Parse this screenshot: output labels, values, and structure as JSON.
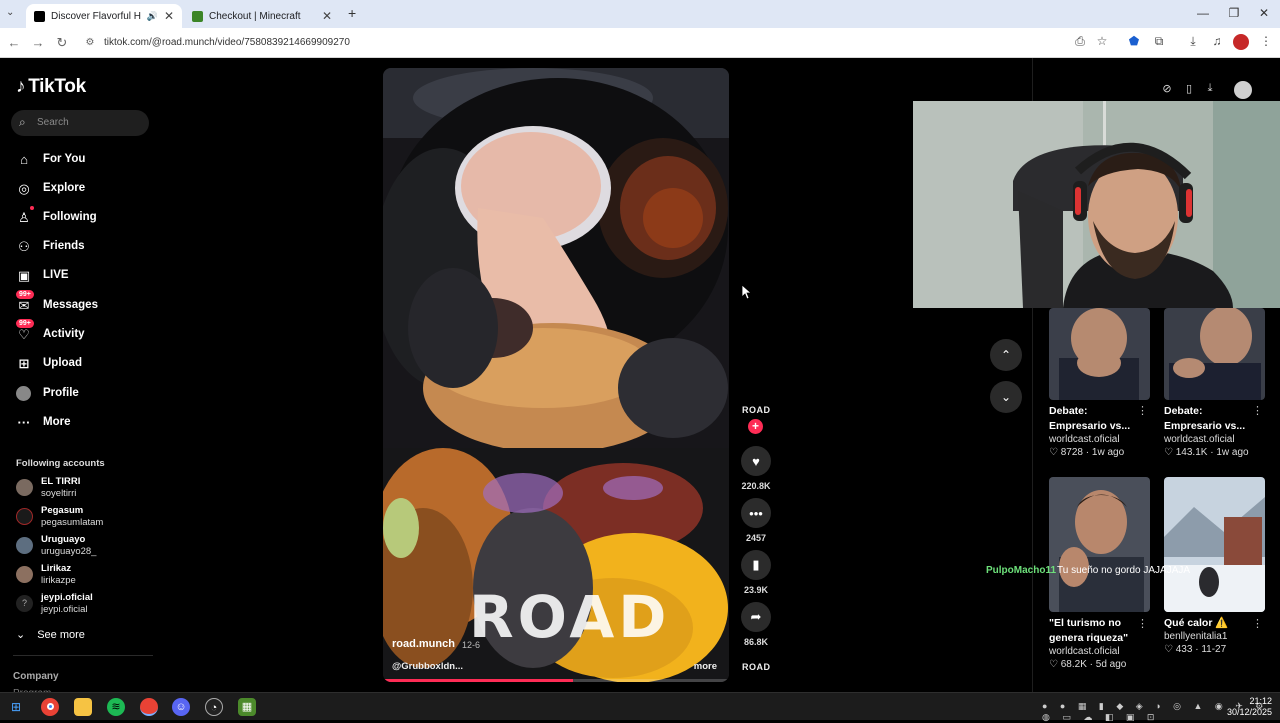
{
  "browser": {
    "tabs": [
      {
        "title": "Discover Flavorful Halal Stre",
        "active": true
      },
      {
        "title": "Checkout | Minecraft",
        "active": false
      }
    ],
    "new_tab_label": "+",
    "url": "tiktok.com/@road.munch/video/7580839214669909270"
  },
  "sidebar": {
    "logo": "TikTok",
    "search_placeholder": "Search",
    "nav": [
      {
        "label": "For You",
        "icon": "home-icon"
      },
      {
        "label": "Explore",
        "icon": "compass-icon"
      },
      {
        "label": "Following",
        "icon": "following-icon"
      },
      {
        "label": "Friends",
        "icon": "friends-icon"
      },
      {
        "label": "LIVE",
        "icon": "live-icon"
      },
      {
        "label": "Messages",
        "icon": "messages-icon",
        "badge": "99+"
      },
      {
        "label": "Activity",
        "icon": "activity-icon",
        "badge": "99+"
      },
      {
        "label": "Upload",
        "icon": "upload-icon"
      },
      {
        "label": "Profile",
        "icon": "profile-icon"
      },
      {
        "label": "More",
        "icon": "more-icon"
      }
    ],
    "following_title": "Following accounts",
    "accounts": [
      {
        "name": "EL TIRRI",
        "handle": "soyeltirri"
      },
      {
        "name": "Pegasum",
        "handle": "pegasumlatam"
      },
      {
        "name": "Uruguayo",
        "handle": "uruguayo28_"
      },
      {
        "name": "Lirikaz",
        "handle": "lirikazpe"
      },
      {
        "name": "jeypi.oficial",
        "handle": "jeypi.oficial"
      }
    ],
    "see_more": "See more",
    "company": "Company",
    "program": "Program"
  },
  "video": {
    "username": "road.munch",
    "date": "12-6",
    "caption": "@Grubboxldn...",
    "more": "more",
    "watermark": "ROAD",
    "progress": 0.55
  },
  "actions": {
    "brand": "ROAD",
    "likes": "220.8K",
    "comments": "2457",
    "saves": "23.9K",
    "shares": "86.8K"
  },
  "recommendations": [
    {
      "title_line1": "Debate:",
      "title_line2": "Empresario vs...",
      "author": "worldcast.oficial",
      "likes": "8728",
      "age": "1w ago"
    },
    {
      "title_line1": "Debate:",
      "title_line2": "Empresario vs...",
      "author": "worldcast.oficial",
      "likes": "143.1K",
      "age": "1w ago"
    },
    {
      "title_line1": "\"El turismo no",
      "title_line2": "genera riqueza\"",
      "author": "worldcast.oficial",
      "likes": "68.2K",
      "age": "5d ago"
    },
    {
      "title_line1": "Qué calor ⚠️",
      "title_line2": "",
      "author": "benllyenitalia1",
      "likes": "433",
      "age": "11-27"
    }
  ],
  "chat_overlay": {
    "user": "PulpoMacho11",
    "message": "Tu sueño no gordo JAJAJAJA"
  },
  "taskbar": {
    "time": "21:12",
    "date": "30/12/2025"
  },
  "colors": {
    "accent": "#fe2c55",
    "background": "#000000",
    "chat_name": "#6de07a"
  }
}
